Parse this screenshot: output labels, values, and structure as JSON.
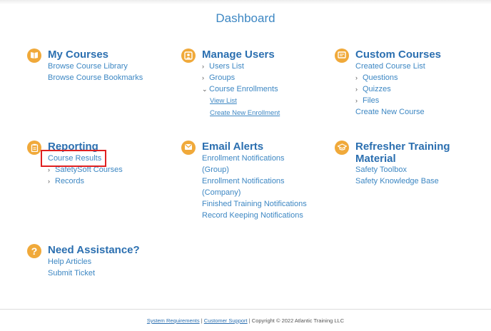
{
  "page": {
    "title": "Dashboard"
  },
  "my_courses": {
    "title": "My Courses",
    "items": [
      "Browse Course Library",
      "Browse Course Bookmarks"
    ]
  },
  "manage_users": {
    "title": "Manage Users",
    "items": [
      "Users List",
      "Groups",
      "Course Enrollments"
    ],
    "sub_items": [
      "View List",
      "Create New Enrollment"
    ]
  },
  "custom_courses": {
    "title": "Custom Courses",
    "items": [
      "Created Course List",
      "Questions",
      "Quizzes",
      "Files",
      "Create New Course"
    ]
  },
  "reporting": {
    "title": "Reporting",
    "items": [
      "Course Results",
      "SafetySoft Courses",
      "Records"
    ]
  },
  "email_alerts": {
    "title": "Email Alerts",
    "items": [
      "Enrollment Notifications",
      "(Group)",
      "Enrollment Notifications",
      "(Company)",
      "Finished Training Notifications",
      "Record Keeping Notifications"
    ]
  },
  "refresher": {
    "title_line1": "Refresher Training",
    "title_line2": "Material",
    "items": [
      "Safety Toolbox",
      "Safety Knowledge Base"
    ]
  },
  "assistance": {
    "title": "Need Assistance?",
    "icon_glyph": "?",
    "items": [
      "Help Articles",
      "Submit Ticket"
    ]
  },
  "footer": {
    "link1": "System Requirements",
    "sep": "|",
    "link2": "Customer Support",
    "copyright": "| Copyright © 2022 Atlantic Training LLC"
  },
  "colors": {
    "accent": "#f0a93a",
    "heading": "#2b6fb0",
    "link": "#3d87c3",
    "highlight": "#e02020"
  }
}
